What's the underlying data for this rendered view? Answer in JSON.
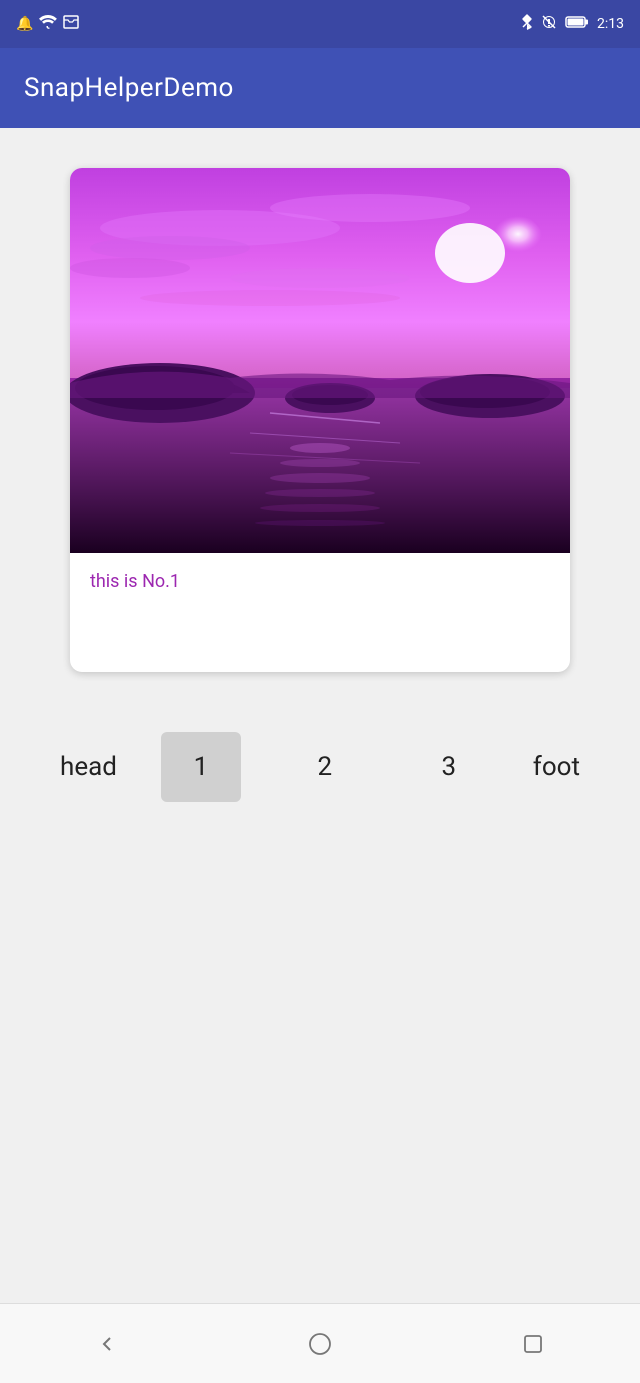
{
  "status_bar": {
    "time": "2:13",
    "icons_left": [
      "notification-icon",
      "wifi-icon",
      "inbox-icon"
    ],
    "icons_right": [
      "bluetooth-icon",
      "mute-icon",
      "battery-icon"
    ]
  },
  "app_bar": {
    "title": "SnapHelperDemo"
  },
  "card": {
    "image_alt": "Purple sunset over ocean",
    "caption": "this is No.1"
  },
  "snap_row": {
    "head_label": "head",
    "foot_label": "foot",
    "items": [
      {
        "label": "1",
        "active": true
      },
      {
        "label": "2",
        "active": false
      },
      {
        "label": "3",
        "active": false
      }
    ]
  },
  "bottom_nav": {
    "back_label": "back",
    "home_label": "home",
    "recents_label": "recents"
  }
}
